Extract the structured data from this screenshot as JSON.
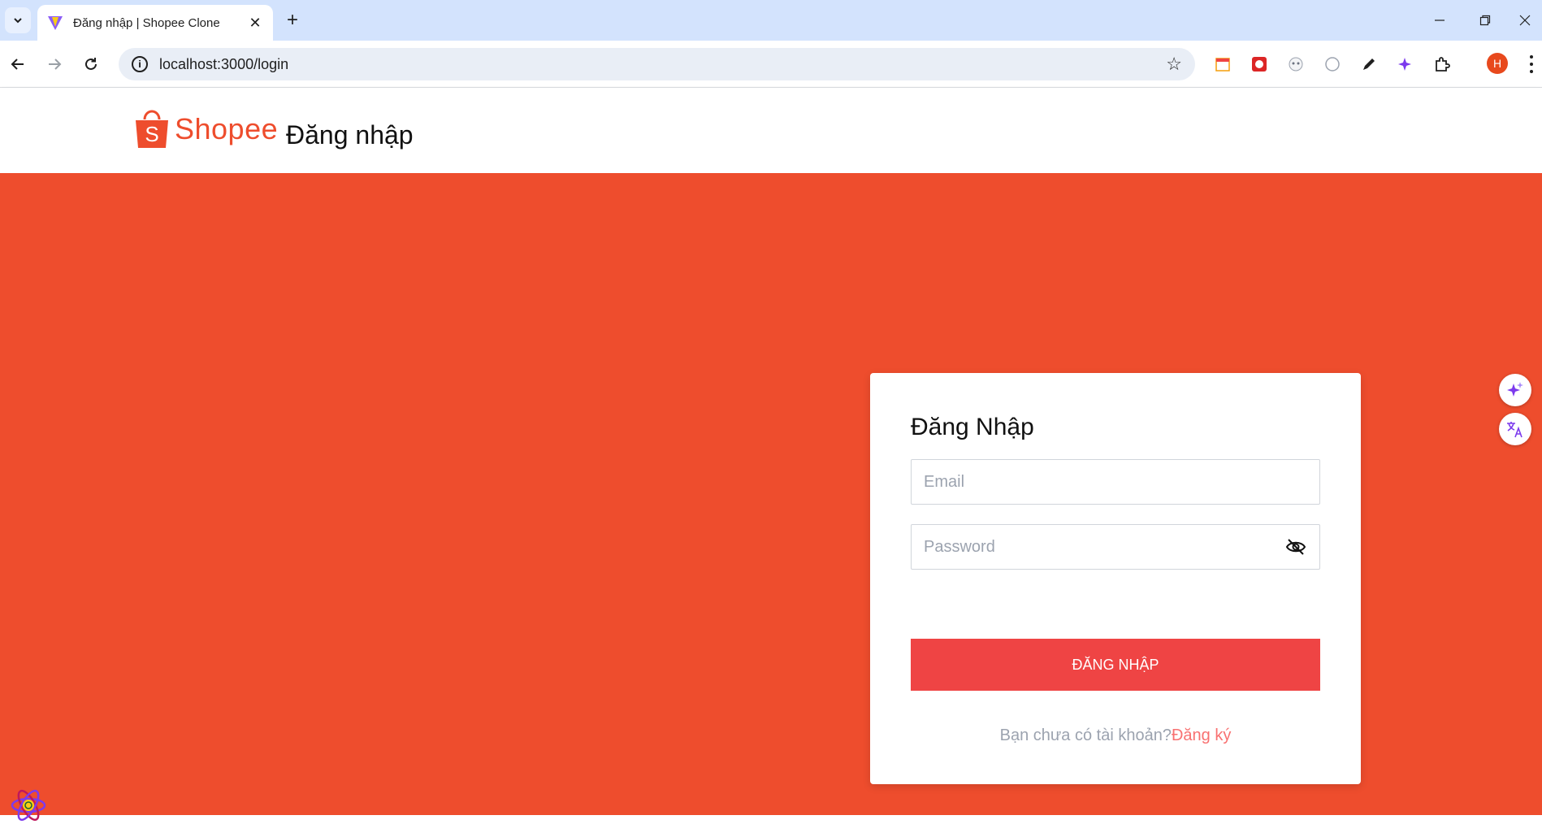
{
  "browser": {
    "tab_title": "Đăng nhập | Shopee Clone",
    "tab_close": "✕",
    "new_tab": "+",
    "url": "localhost:3000/login",
    "avatar_initial": "H",
    "window_controls": [
      "minimize-icon",
      "restore-icon",
      "close-icon"
    ]
  },
  "header": {
    "logo_text": "Shopee",
    "page_title": "Đăng nhập",
    "brand_color": "#ee4d2d"
  },
  "login_form": {
    "title": "Đăng Nhập",
    "email_placeholder": "Email",
    "password_placeholder": "Password",
    "submit_label": "ĐĂNG NHẬP",
    "signup_question": "Bạn chưa có tài khoản?",
    "signup_link": "Đăng ký",
    "button_color": "#ef4444"
  }
}
